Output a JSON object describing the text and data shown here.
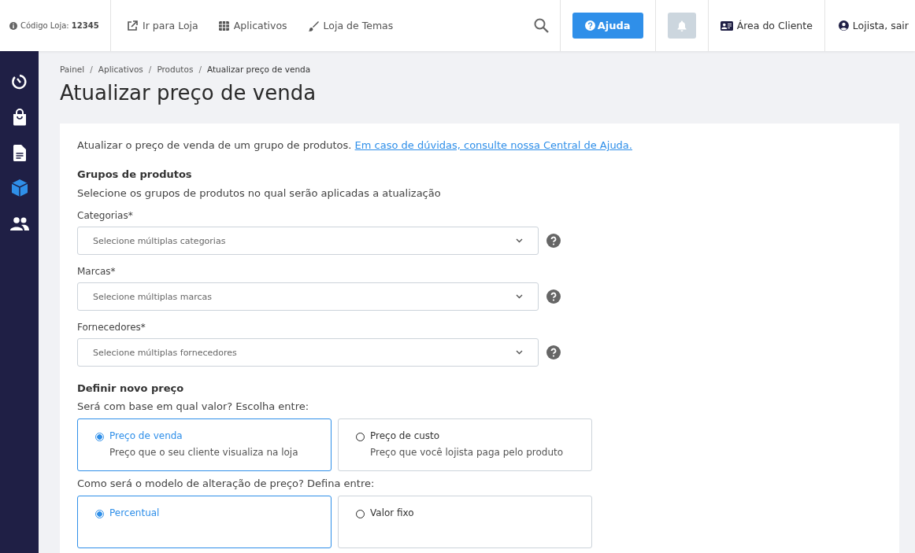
{
  "topbar": {
    "store_code_label": "Código Loja:",
    "store_code": "12345",
    "links": [
      {
        "kind": "external",
        "label": "Ir para Loja"
      },
      {
        "kind": "grid",
        "label": "Aplicativos"
      },
      {
        "kind": "brush",
        "label": "Loja de Temas"
      }
    ],
    "help_button": "Ajuda",
    "client_area": "Área do Cliente",
    "user": "Lojista, sair"
  },
  "sidebar": {
    "items": [
      {
        "kind": "dashboard",
        "selected": false
      },
      {
        "kind": "bag",
        "selected": false
      },
      {
        "kind": "document",
        "selected": false
      },
      {
        "kind": "box",
        "selected": true
      },
      {
        "kind": "people",
        "selected": false
      }
    ]
  },
  "breadcrumb_separator": "/",
  "breadcrumb": [
    "Painel",
    "Aplicativos",
    "Produtos",
    "Atualizar preço de venda"
  ],
  "page_title": "Atualizar preço de venda",
  "intro": {
    "text": "Atualizar o preço de venda de um grupo de produtos.",
    "link": "Em caso de dúvidas, consulte nossa Central de Ajuda."
  },
  "groups": {
    "heading": "Grupos de produtos",
    "description": "Selecione os grupos de produtos no qual serão aplicadas a atualização",
    "fields": [
      {
        "label": "Categorias*",
        "placeholder": "Selecione múltiplas categorias"
      },
      {
        "label": "Marcas*",
        "placeholder": "Selecione múltiplas marcas"
      },
      {
        "label": "Fornecedores*",
        "placeholder": "Selecione múltiplas fornecedores"
      }
    ]
  },
  "new_price": {
    "heading": "Definir novo preço",
    "questions": [
      {
        "text": "Será com base em qual valor? Escolha entre:",
        "options": [
          {
            "title": "Preço de venda",
            "description": "Preço que o seu cliente visualiza na loja",
            "selected": true
          },
          {
            "title": "Preço de custo",
            "description": "Preço que você lojista paga pelo produto",
            "selected": false
          }
        ]
      },
      {
        "text": "Como será o modelo de alteração de preço? Defina entre:",
        "options": [
          {
            "title": "Percentual",
            "selected": true
          },
          {
            "title": "Valor fixo",
            "selected": false
          }
        ]
      }
    ]
  }
}
